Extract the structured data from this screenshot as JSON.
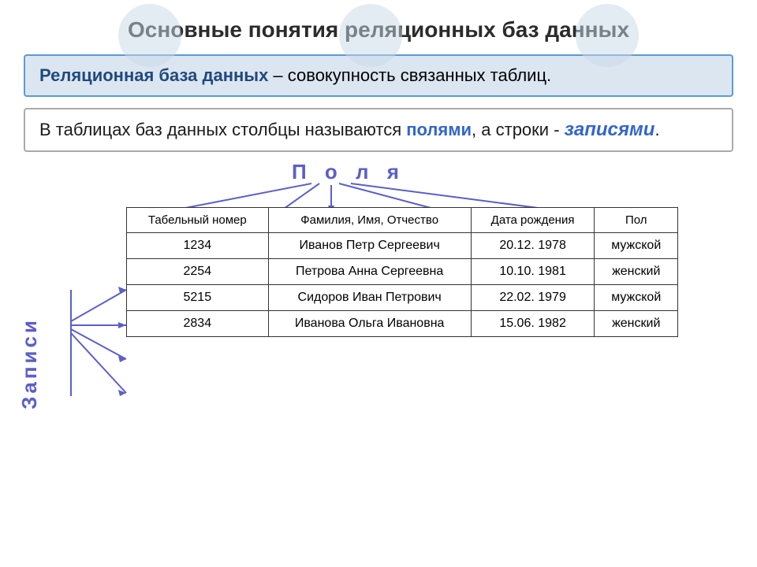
{
  "title": "Основные понятия реляционных баз данных",
  "definition": {
    "term": "Реляционная база данных",
    "rest": " – совокупность связанных таблиц."
  },
  "second_paragraph": {
    "prefix": "В таблицах баз данных столбцы называются ",
    "word1": "полями",
    "middle": ", а строки - ",
    "word2": "записями",
    "suffix": "."
  },
  "polya_label": "П о л я",
  "zapisi_label": "Записи",
  "table": {
    "headers": [
      "Табельный номер",
      "Фамилия, Имя, Отчество",
      "Дата рождения",
      "Пол"
    ],
    "rows": [
      [
        "1234",
        "Иванов Петр Сергеевич",
        "20.12. 1978",
        "мужской"
      ],
      [
        "2254",
        "Петрова Анна Сергеевна",
        "10.10. 1981",
        "женский"
      ],
      [
        "5215",
        "Сидоров Иван Петрович",
        "22.02. 1979",
        "мужской"
      ],
      [
        "2834",
        "Иванова Ольга Ивановна",
        "15.06. 1982",
        "женский"
      ]
    ]
  }
}
